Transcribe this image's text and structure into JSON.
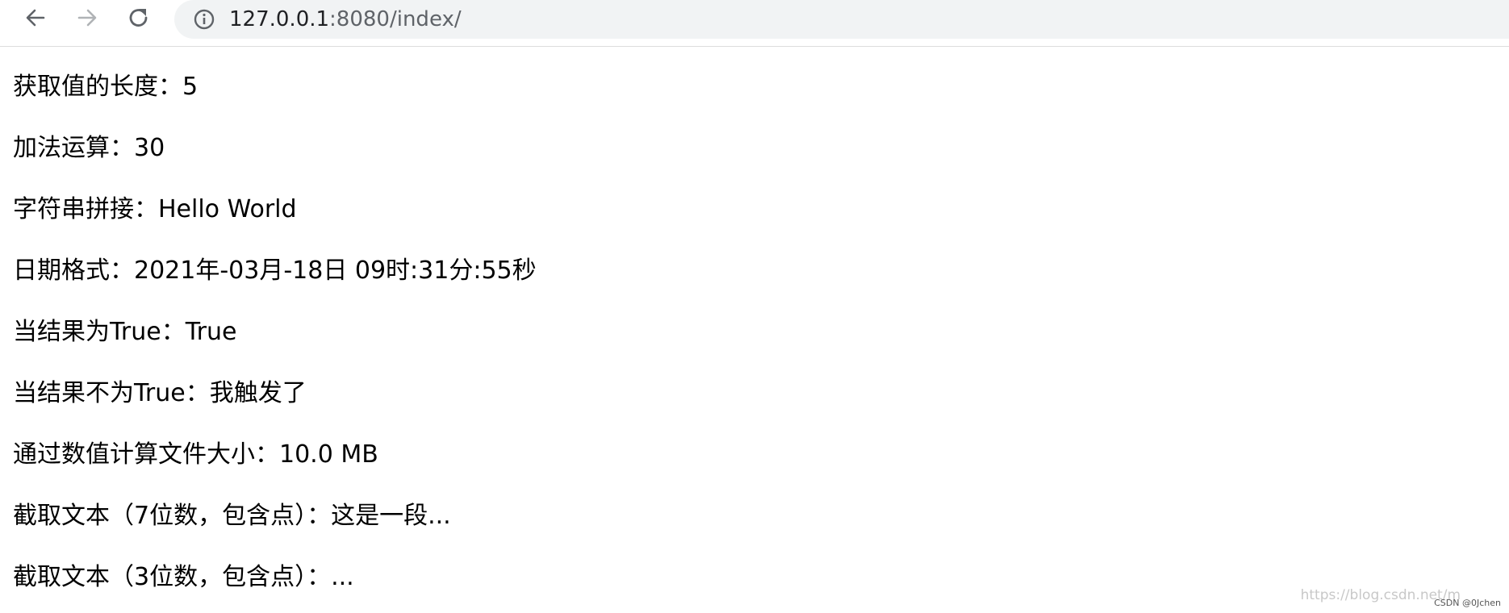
{
  "browser": {
    "url_host": "127.0.0.1",
    "url_rest": ":8080/index/",
    "icons": {
      "back": "arrow-left-icon",
      "forward": "arrow-right-icon",
      "reload": "reload-icon",
      "info": "info-icon"
    },
    "colors": {
      "omnibox_bg": "#f1f3f4",
      "forward_disabled": "#b0b3b6",
      "icon": "#5f6368"
    }
  },
  "content": {
    "lines": [
      "获取值的长度：5",
      "加法运算：30",
      "字符串拼接：Hello World",
      "日期格式：2021年-03月-18日 09时:31分:55秒",
      "当结果为True：True",
      "当结果不为True：我触发了",
      "通过数值计算文件大小：10.0 MB",
      "截取文本（7位数，包含点）：这是一段...",
      "截取文本（3位数，包含点）：..."
    ]
  },
  "watermark": {
    "blog": "https://blog.csdn.net/m",
    "author": "CSDN @0Jchen"
  }
}
